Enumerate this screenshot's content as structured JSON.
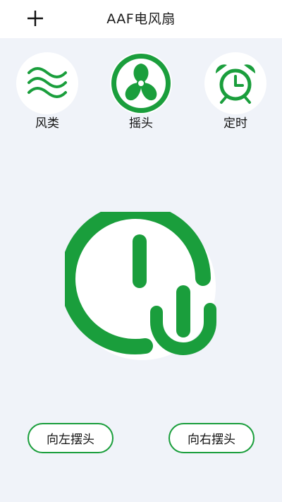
{
  "header": {
    "title": "AAF电风扇"
  },
  "modes": [
    {
      "label": "风类",
      "icon": "wind-icon"
    },
    {
      "label": "摇头",
      "icon": "fan-icon"
    },
    {
      "label": "定时",
      "icon": "alarm-clock-icon"
    }
  ],
  "power": {
    "icon": "power-icon"
  },
  "swing": {
    "left_label": "向左摆头",
    "right_label": "向右摆头"
  },
  "colors": {
    "accent": "#1a9e3c",
    "background": "#f0f3f9",
    "surface": "#ffffff"
  }
}
